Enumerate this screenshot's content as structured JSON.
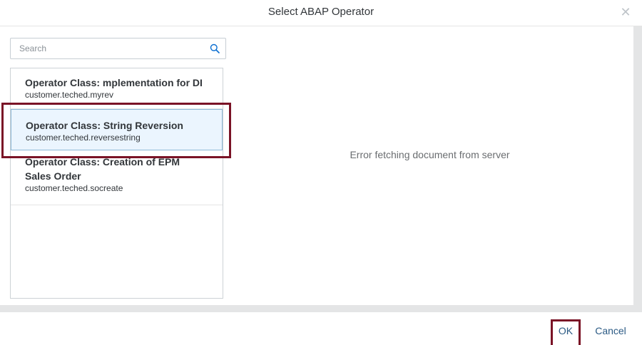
{
  "dialog": {
    "title": "Select ABAP Operator",
    "close_icon": "close-icon"
  },
  "search": {
    "placeholder": "Search",
    "value": "",
    "icon": "search-icon"
  },
  "operators": [
    {
      "title": "Operator Class: mplementation for DI",
      "subtitle": "customer.teched.myrev",
      "selected": false
    },
    {
      "title": "Operator Class: String Reversion",
      "subtitle": "customer.teched.reversestring",
      "selected": true
    },
    {
      "title": "Operator Class: Creation of EPM Sales Order",
      "subtitle": "customer.teched.socreate",
      "selected": false
    }
  ],
  "detail": {
    "message": "Error fetching document from server"
  },
  "footer": {
    "ok_label": "OK",
    "cancel_label": "Cancel"
  },
  "colors": {
    "accent": "#0a6ed1",
    "selected_bg": "#ebf5fe",
    "annotation": "#7a1326"
  }
}
